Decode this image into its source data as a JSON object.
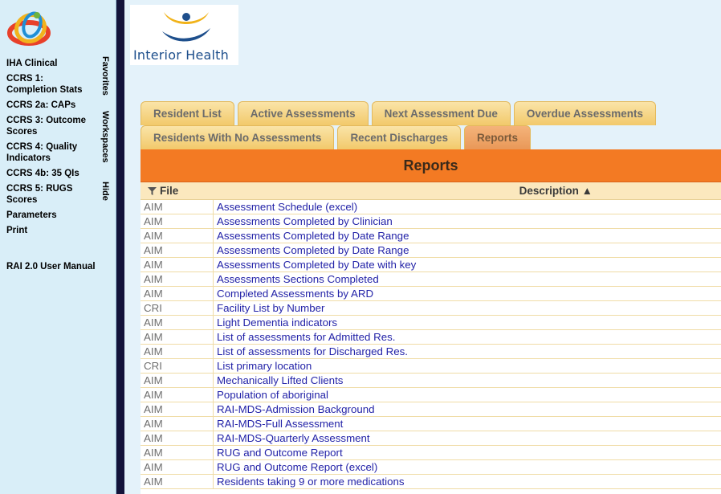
{
  "sidebar": {
    "nav": [
      "IHA Clinical",
      "CCRS 1: Completion Stats",
      "CCRS 2a: CAPs",
      "CCRS 3: Outcome Scores",
      "CCRS 4: Quality Indicators",
      "CCRS 4b: 35 QIs",
      "CCRS 5: RUGS Scores",
      "Parameters",
      "Print",
      "RAI 2.0 User Manual"
    ],
    "vertical_tabs": [
      "Favorites",
      "Workspaces",
      "Hide"
    ]
  },
  "brand": {
    "text": "Interior Health",
    "colors": {
      "blue": "#1e4f8c",
      "gold": "#f1b31a"
    }
  },
  "tabs": {
    "row1": [
      "Resident List",
      "Active Assessments",
      "Next Assessment Due",
      "Overdue Assessments"
    ],
    "row2": [
      "Residents With No Assessments",
      "Recent Discharges",
      "Reports"
    ],
    "active": "Reports"
  },
  "panel": {
    "title": "Reports",
    "columns": {
      "file": "File",
      "description": "Description ▲"
    },
    "rows": [
      {
        "file": "AIM",
        "description": "Assessment Schedule (excel)"
      },
      {
        "file": "AIM",
        "description": "Assessments Completed by Clinician"
      },
      {
        "file": "AIM",
        "description": "Assessments Completed by Date Range"
      },
      {
        "file": "AIM",
        "description": "Assessments Completed by Date Range"
      },
      {
        "file": "AIM",
        "description": "Assessments Completed by Date with key"
      },
      {
        "file": "AIM",
        "description": "Assessments Sections Completed"
      },
      {
        "file": "AIM",
        "description": "Completed Assessments by ARD"
      },
      {
        "file": "CRI",
        "description": "Facility List by Number"
      },
      {
        "file": "AIM",
        "description": "Light Dementia indicators"
      },
      {
        "file": "AIM",
        "description": "List of assessments for Admitted Res."
      },
      {
        "file": "AIM",
        "description": "List of assessments for Discharged Res."
      },
      {
        "file": "CRI",
        "description": "List primary location"
      },
      {
        "file": "AIM",
        "description": "Mechanically Lifted Clients"
      },
      {
        "file": "AIM",
        "description": "Population of aboriginal"
      },
      {
        "file": "AIM",
        "description": "RAI-MDS-Admission Background"
      },
      {
        "file": "AIM",
        "description": "RAI-MDS-Full Assessment"
      },
      {
        "file": "AIM",
        "description": "RAI-MDS-Quarterly Assessment"
      },
      {
        "file": "AIM",
        "description": "RUG and Outcome Report"
      },
      {
        "file": "AIM",
        "description": "RUG and Outcome Report (excel)"
      },
      {
        "file": "AIM",
        "description": "Residents taking 9 or more medications"
      }
    ]
  },
  "colors": {
    "sidebar_bg": "#d9eef8",
    "divider": "#13133a",
    "main_bg": "#e4f2fa",
    "tab": "#f2c96b",
    "tab_active": "#e99858",
    "header_orange": "#f37a23",
    "link": "#2323a8"
  }
}
